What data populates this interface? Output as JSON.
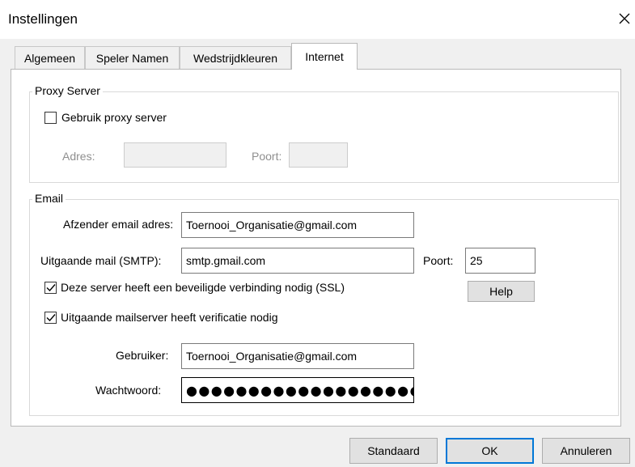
{
  "window": {
    "title": "Instellingen",
    "close_icon": "close-icon"
  },
  "tabs": [
    {
      "label": "Algemeen",
      "active": false
    },
    {
      "label": "Speler Namen",
      "active": false
    },
    {
      "label": "Wedstrijdkleuren",
      "active": false
    },
    {
      "label": "Internet",
      "active": true
    }
  ],
  "proxy": {
    "legend": "Proxy Server",
    "use_proxy_label": "Gebruik proxy server",
    "use_proxy_checked": false,
    "address_label": "Adres:",
    "address_value": "",
    "port_label": "Poort:",
    "port_value": ""
  },
  "email": {
    "legend": "Email",
    "sender_label": "Afzender email adres:",
    "sender_value": "Toernooi_Organisatie@gmail.com",
    "smtp_label": "Uitgaande mail (SMTP):",
    "smtp_value": "smtp.gmail.com",
    "port_label": "Poort:",
    "port_value": "25",
    "ssl_label": "Deze server heeft een beveiligde verbinding nodig (SSL)",
    "ssl_checked": true,
    "help_label": "Help",
    "auth_label": "Uitgaande mailserver heeft verificatie nodig",
    "auth_checked": true,
    "user_label": "Gebruiker:",
    "user_value": "Toernooi_Organisatie@gmail.com",
    "password_label": "Wachtwoord:",
    "password_value": "●●●●●●●●●●●●●●●●●●●●●●●●●●●"
  },
  "buttons": {
    "default_label": "Standaard",
    "ok_label": "OK",
    "cancel_label": "Annuleren"
  },
  "colors": {
    "focus_border": "#0078d7",
    "background": "#f0f0f0"
  }
}
